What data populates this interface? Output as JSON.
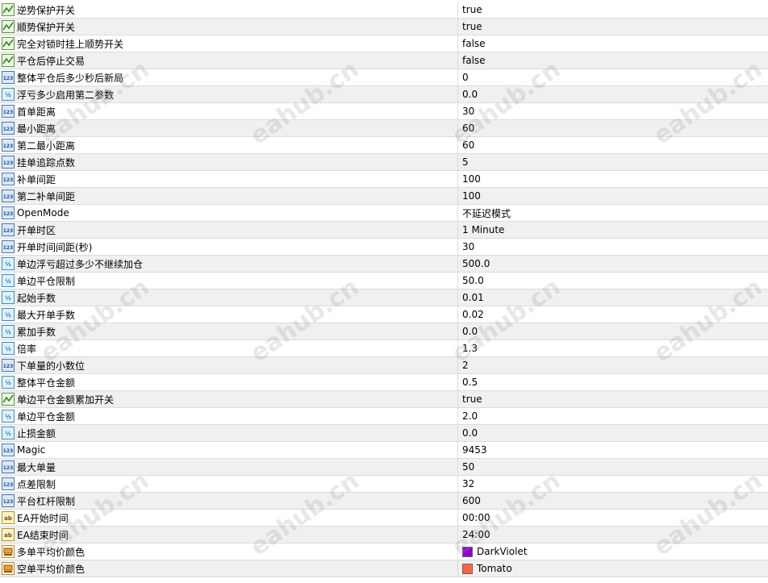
{
  "params": [
    {
      "name": "逆势保护开关",
      "value": "true",
      "type": "bool"
    },
    {
      "name": "顺势保护开关",
      "value": "true",
      "type": "bool"
    },
    {
      "name": "完全对锁时挂上顺势开关",
      "value": "false",
      "type": "bool"
    },
    {
      "name": "平仓后停止交易",
      "value": "false",
      "type": "bool"
    },
    {
      "name": "整体平仓后多少秒后新局",
      "value": "0",
      "type": "int"
    },
    {
      "name": "浮亏多少启用第二参数",
      "value": "0.0",
      "type": "double"
    },
    {
      "name": "首单距离",
      "value": "30",
      "type": "int"
    },
    {
      "name": "最小距离",
      "value": "60",
      "type": "int"
    },
    {
      "name": "第二最小距离",
      "value": "60",
      "type": "int"
    },
    {
      "name": "挂单追踪点数",
      "value": "5",
      "type": "int"
    },
    {
      "name": "补单间距",
      "value": "100",
      "type": "int"
    },
    {
      "name": "第二补单间距",
      "value": "100",
      "type": "int"
    },
    {
      "name": "OpenMode",
      "value": "不延迟模式",
      "type": "int"
    },
    {
      "name": "开单时区",
      "value": "1 Minute",
      "type": "int"
    },
    {
      "name": "开单时间间距(秒)",
      "value": "30",
      "type": "int"
    },
    {
      "name": "单边浮亏超过多少不继续加仓",
      "value": "500.0",
      "type": "double"
    },
    {
      "name": "单边平仓限制",
      "value": "50.0",
      "type": "double"
    },
    {
      "name": "起始手数",
      "value": "0.01",
      "type": "double"
    },
    {
      "name": "最大开单手数",
      "value": "0.02",
      "type": "double"
    },
    {
      "name": "累加手数",
      "value": "0.0",
      "type": "double"
    },
    {
      "name": "倍率",
      "value": "1.3",
      "type": "double"
    },
    {
      "name": "下单量的小数位",
      "value": "2",
      "type": "int"
    },
    {
      "name": "整体平仓金额",
      "value": "0.5",
      "type": "double"
    },
    {
      "name": "单边平仓金额累加开关",
      "value": "true",
      "type": "bool"
    },
    {
      "name": "单边平仓金额",
      "value": "2.0",
      "type": "double"
    },
    {
      "name": "止损金额",
      "value": "0.0",
      "type": "double"
    },
    {
      "name": "Magic",
      "value": "9453",
      "type": "int"
    },
    {
      "name": "最大单量",
      "value": "50",
      "type": "int"
    },
    {
      "name": "点差限制",
      "value": "32",
      "type": "int"
    },
    {
      "name": "平台杠杆限制",
      "value": "600",
      "type": "int"
    },
    {
      "name": "EA开始时间",
      "value": "00:00",
      "type": "string"
    },
    {
      "name": "EA结束时间",
      "value": "24:00",
      "type": "string"
    },
    {
      "name": "多单平均价颜色",
      "value": "DarkViolet",
      "type": "color",
      "color": "#9400d3"
    },
    {
      "name": "空单平均价颜色",
      "value": "Tomato",
      "type": "color",
      "color": "#ff6347"
    }
  ],
  "watermark": "eahub.cn"
}
